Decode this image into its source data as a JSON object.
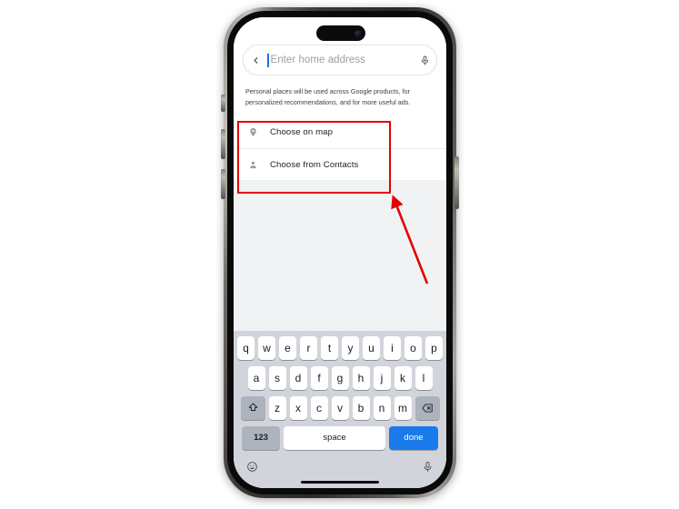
{
  "device": {
    "name": "iphone-15-pro",
    "dynamic_island": true,
    "home_indicator": true
  },
  "search": {
    "back_icon": "chevron-left-icon",
    "placeholder": "Enter home address",
    "value": "",
    "mic_icon": "microphone-icon",
    "caret_color": "#1a73e8"
  },
  "disclaimer": {
    "text": "Personal places will be used across Google products, for personalized recommendations, and for more useful ads."
  },
  "options": [
    {
      "icon": "location-pin-icon",
      "label": "Choose on map"
    },
    {
      "icon": "person-icon",
      "label": "Choose from Contacts"
    }
  ],
  "keyboard": {
    "rows": [
      [
        "q",
        "w",
        "e",
        "r",
        "t",
        "y",
        "u",
        "i",
        "o",
        "p"
      ],
      [
        "a",
        "s",
        "d",
        "f",
        "g",
        "h",
        "j",
        "k",
        "l"
      ],
      [
        "z",
        "x",
        "c",
        "v",
        "b",
        "n",
        "m"
      ]
    ],
    "shift_icon": "shift-arrow-icon",
    "delete_icon": "backspace-icon",
    "numbers_key": "123",
    "space_key": "space",
    "return_key": "done",
    "emoji_icon": "emoji-smiley-icon",
    "dictation_icon": "microphone-icon",
    "return_key_color": "#1a7aeb"
  },
  "annotations": {
    "highlight_box": {
      "color": "#e30000",
      "target": "options-list"
    },
    "arrow": {
      "color": "#e30000",
      "points_to": "options-list"
    }
  }
}
